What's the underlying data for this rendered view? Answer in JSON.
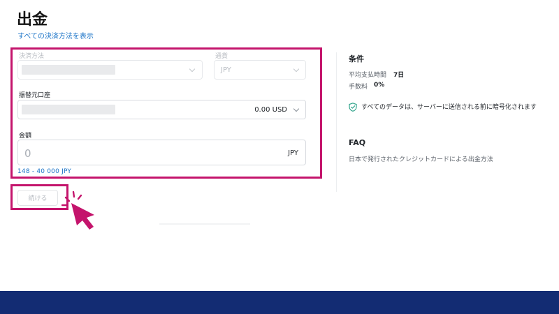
{
  "header": {
    "title": "出金",
    "all_methods_link": "すべての決済方法を表示"
  },
  "form": {
    "payment_method": {
      "label": "決済方法",
      "value": ""
    },
    "currency": {
      "label": "通貨",
      "value": "JPY"
    },
    "source_account": {
      "label": "振替元口座",
      "balance": "0.00 USD"
    },
    "amount": {
      "label": "金額",
      "value": "0",
      "currency": "JPY",
      "range": "148 - 40 000 JPY"
    },
    "continue_label": "続ける"
  },
  "conditions": {
    "heading": "条件",
    "items": [
      {
        "label": "平均支払時間",
        "value": "7日"
      },
      {
        "label": "手数料",
        "value": "0%"
      }
    ],
    "security_note": "すべてのデータは、サーバーに送信される前に暗号化されます"
  },
  "faq": {
    "heading": "FAQ",
    "question": "日本で発行されたクレジットカードによる出金方法"
  },
  "colors": {
    "highlight": "#c4146c",
    "link": "#1a73c7",
    "footer": "#132c73",
    "shield": "#2fa38a"
  }
}
